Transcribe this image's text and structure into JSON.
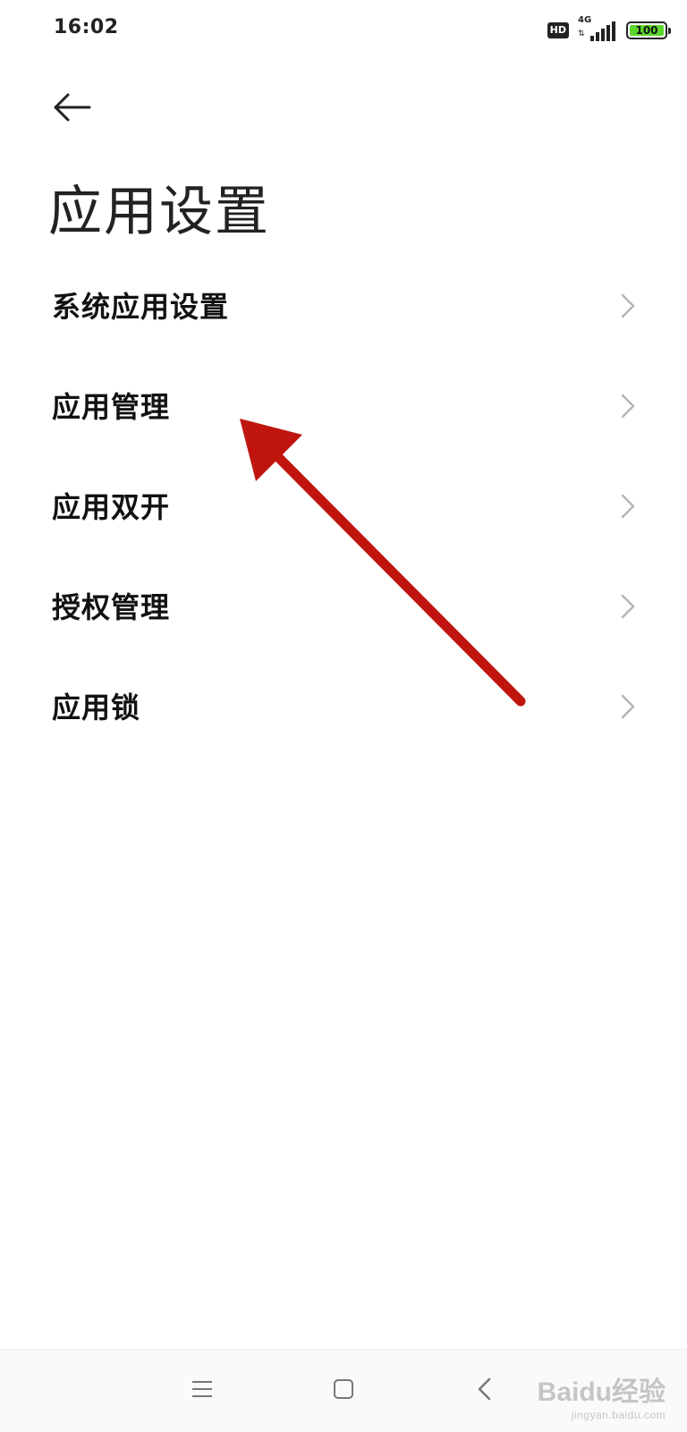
{
  "status_bar": {
    "time": "16:02",
    "hd_badge": "HD",
    "network": "4G",
    "battery_level": "100"
  },
  "page": {
    "title": "应用设置"
  },
  "menu": {
    "items": [
      {
        "label": "系统应用设置"
      },
      {
        "label": "应用管理"
      },
      {
        "label": "应用双开"
      },
      {
        "label": "授权管理"
      },
      {
        "label": "应用锁"
      }
    ]
  },
  "annotation": {
    "color": "#c0150f",
    "points_to": "应用管理"
  },
  "watermark": {
    "brand": "Baidu经验",
    "url": "jingyan.baidu.com"
  },
  "icons": {
    "back": "back-arrow-icon",
    "chevron": "chevron-right-icon",
    "nav_menu": "menu-icon",
    "nav_home": "home-icon",
    "nav_back": "back-icon"
  }
}
